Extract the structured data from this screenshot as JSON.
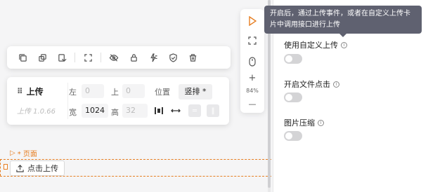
{
  "toolbar": {
    "items": [
      "copy-icon",
      "duplicate-icon",
      "paste-icon",
      "fit-icon",
      "hide-icon",
      "lock-icon",
      "event-icon",
      "check-icon",
      "delete-icon"
    ]
  },
  "component": {
    "name": "上传",
    "version": "上传 1.0.66"
  },
  "props": {
    "left_label": "左",
    "left_value": "0",
    "top_label": "上",
    "top_value": "0",
    "position_label": "位置",
    "position_value": "竖排 *",
    "width_label": "宽",
    "width_value": "1024",
    "height_label": "高",
    "height_value": "32"
  },
  "page": {
    "tag": "* 页面",
    "upload_button": "点击上传"
  },
  "side_tools": {
    "zoom": "84%",
    "plus": "+",
    "minus": "—"
  },
  "right_panel": {
    "tooltip": "开启后，通过上传事件，或者在自定义上传卡片中调用接口进行上传",
    "setting1": "使用自定义上传",
    "setting2": "开启文件点击",
    "setting3": "图片压缩"
  },
  "colors": {
    "accent": "#e67e22",
    "tooltip_bg": "#5f6170"
  }
}
